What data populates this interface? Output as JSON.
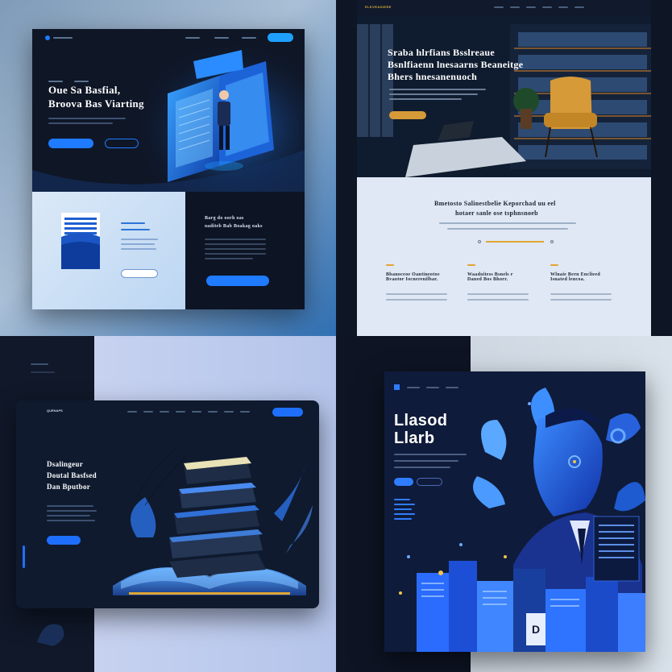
{
  "q1": {
    "brand": "",
    "nav_items": [
      "",
      "",
      ""
    ],
    "cta": "",
    "eyebrow": [
      "",
      ""
    ],
    "headline_line1": "Oue Sa Basfial,",
    "headline_line2": "Broova Bas Viarting",
    "primary_btn": "",
    "secondary_btn": "",
    "panel_title": "Barg  do  oorh  oas",
    "panel_title2": "oaditeb  Bab  Boakag oaks",
    "accent": "#1f7bff"
  },
  "q2": {
    "logo": "ELEVRADIERE",
    "headline_line1": "Sraba hlrfians  Bsslreaue",
    "headline_line2": "Bsnlfiaenn lnesaarns Beaneitge",
    "headline_line3": "Bhers  hnesanenuoch",
    "section_title1": "Bmetosto  Salinestbelie  Keporchad  uu  eel",
    "section_title2": "hotaer  sanle  ose  tsphnsnoeb",
    "features": [
      {
        "title1": "Bbanoceoe  Oantineotoe",
        "title2": "Bvaotor  Iocnerenilbar."
      },
      {
        "title1": "Waadoitess  Bsnels  r",
        "title2": "Daned  Bos  Bhorr."
      },
      {
        "title1": "Wlnaie  Bern  Enclieed",
        "title2": "Isnated  lencoa."
      }
    ],
    "accent": "#f0b23d"
  },
  "q3": {
    "brand": "QUENAPS",
    "headline_line1": "Dsalingeur",
    "headline_line2": "Doutal  Basfsed",
    "headline_line3": "Dan  Bputbor",
    "cta_btn": "",
    "accent": "#1f6fff"
  },
  "q4": {
    "headline_line1": "Llasod",
    "headline_line2": "Llarb",
    "chip_letter": "D",
    "accent": "#2962ff"
  }
}
